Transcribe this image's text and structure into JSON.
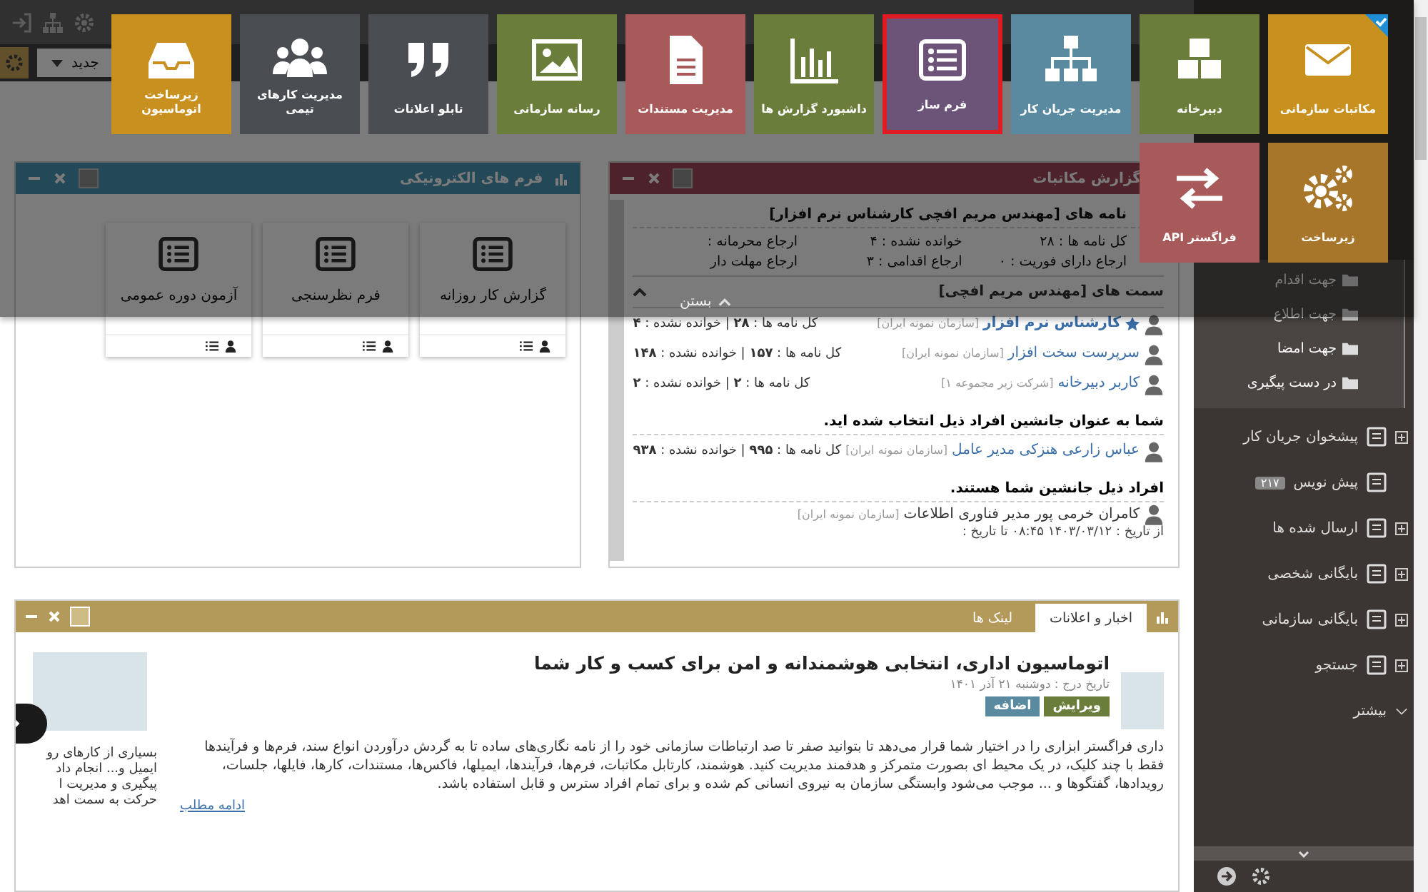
{
  "toolbar": {
    "new_button": "جدید"
  },
  "menu": {
    "tiles": [
      {
        "label": "مکاتبات سازمانی",
        "color": "#c8901f",
        "selected": false,
        "checked": true
      },
      {
        "label": "دبیرخانه",
        "color": "#6b7d3a",
        "selected": false,
        "checked": false
      },
      {
        "label": "مدیریت جریان کار",
        "color": "#5a8aa0",
        "selected": false,
        "checked": false
      },
      {
        "label": "فرم ساز",
        "color": "#6b5478",
        "selected": true,
        "checked": false
      },
      {
        "label": "داشبورد گزارش ها",
        "color": "#6b7d3a",
        "selected": false,
        "checked": false
      },
      {
        "label": "مدیریت مستندات",
        "color": "#a85a5a",
        "selected": false,
        "checked": false
      },
      {
        "label": "رسانه سازمانی",
        "color": "#6b7d3a",
        "selected": false,
        "checked": false
      },
      {
        "label": "تابلو اعلانات",
        "color": "#4a4d52",
        "selected": false,
        "checked": false
      },
      {
        "label": "مدیریت کارهای تیمی",
        "color": "#4a4d52",
        "selected": false,
        "checked": false
      },
      {
        "label": "زیرساخت اتوماسیون",
        "color": "#c8901f",
        "selected": false,
        "checked": false
      },
      {
        "label": "زیرساخت",
        "color": "#a8762a",
        "selected": false,
        "checked": false
      },
      {
        "label": "فراگستر API",
        "color": "#a85a5a",
        "selected": false,
        "checked": false
      }
    ],
    "close_label": "بستن"
  },
  "forms_panel": {
    "title": "فرم های الکترونیکی",
    "forms": [
      {
        "label": "گزارش کار روزانه"
      },
      {
        "label": "فرم نظرسنجی"
      },
      {
        "label": "آزمون دوره عمومی"
      }
    ]
  },
  "report_panel": {
    "title": "گزارش مکاتبات",
    "heading": "نامه های [مهندس مریم افچی کارشناس نرم افزار]",
    "stats": [
      "کل نامه ها : ۲۸",
      "خوانده نشده : ۴",
      "ارجاع محرمانه :",
      "ارجاع دارای فوریت : ۰",
      "ارجاع اقدامی : ۳",
      "ارجاع مهلت دار"
    ],
    "roles_heading": "سمت های [مهندس مریم افچی]",
    "roles": [
      {
        "name": "کارشناس نرم افزار",
        "org": "[سازمان نمونه ایران]",
        "counts": "کل نامه ها : **۲۸** | خوانده نشده : **۴**",
        "starred": true
      },
      {
        "name": "سرپرست سخت افزار",
        "org": "[سازمان نمونه ایران]",
        "counts": "کل نامه ها : **۱۵۷** | خوانده نشده : **۱۴۸**",
        "starred": false
      },
      {
        "name": "کاربر دبیرخانه",
        "org": "[شرکت زیر مجموعه ۱]",
        "counts": "کل نامه ها : **۲** | خوانده نشده : **۲**",
        "starred": false
      }
    ],
    "deputy_heading": "شما به عنوان جانشین افراد ذیل انتخاب شده اید.",
    "deputies": [
      {
        "name": "عباس زارعی هنزکی مدیر عامل",
        "org": "[سازمان نمونه ایران]",
        "counts": "کل نامه ها : **۹۹۵** | خوانده نشده : **۹۳۸**"
      }
    ],
    "substitutes_heading": "افراد ذیل جانشین شما هستند.",
    "substitutes": [
      {
        "name": "کامران خرمی پور مدیر فناوری اطلاعات",
        "org": "[سازمان نمونه ایران]",
        "period": "از تاریخ : ۱۴۰۳/۰۳/۱۲ ۰۸:۴۵ تا تاریخ :"
      }
    ]
  },
  "news_panel": {
    "tabs": [
      {
        "label": "اخبار و اعلانات",
        "selected": true
      },
      {
        "label": "لینک ها",
        "selected": false
      }
    ],
    "item": {
      "title": "اتوماسیون اداری، انتخابی هوشمندانه و امن برای کسب و کار شما",
      "date": "تاریخ درج : دوشنبه ۲۱ آذر ۱۴۰۱",
      "edit_button": "ویرایش",
      "add_button": "اضافه",
      "paragraph": "داری فراگستر ابزاری را در اختیار شما قرار می‌دهد تا بتوانید صفر تا صد ارتباطات سازمانی خود را از نامه نگاری‌های ساده تا به گردش درآوردن انواع سند، فرم‌ها و فرآیندها فقط با چند کلیک، در یک محیط ای بصورت متمرکز و هدفمند مدیریت کنید. هوشمند، کارتابل مکاتبات، فرم‌ها، فرآیندها، ایمیلها، فاکس‌ها، مستندات، کارها، فایلها، جلسات، رویدادها، گفتگوها و ... موجب می‌شود وابستگی سازمان به نیروی انسانی کم شده و برای تمام افراد سترس و قابل استفاده باشد.",
      "link": "ادامه مطلب"
    },
    "next_item_lines": [
      "بسیاری از کارهای رو",
      "ایمیل و... انجام داد",
      "پیگیری و مدیریت ا",
      "حرکت به سمت اهد"
    ]
  },
  "sidebar": {
    "folders": [
      "جهت اقدام",
      "جهت اطلاع",
      "جهت امضا",
      "در دست پیگیری"
    ],
    "items": [
      {
        "label": "پیشخوان جریان کار",
        "kind": "group"
      },
      {
        "label": "پیش نویس",
        "kind": "leaf",
        "badge": "۲۱۷"
      },
      {
        "label": "ارسال شده ها",
        "kind": "group"
      },
      {
        "label": "بایگانی شخصی",
        "kind": "group"
      },
      {
        "label": "بایگانی سازمانی",
        "kind": "group"
      },
      {
        "label": "جستجو",
        "kind": "group"
      },
      {
        "label": "بیشتر",
        "kind": "more"
      }
    ]
  }
}
